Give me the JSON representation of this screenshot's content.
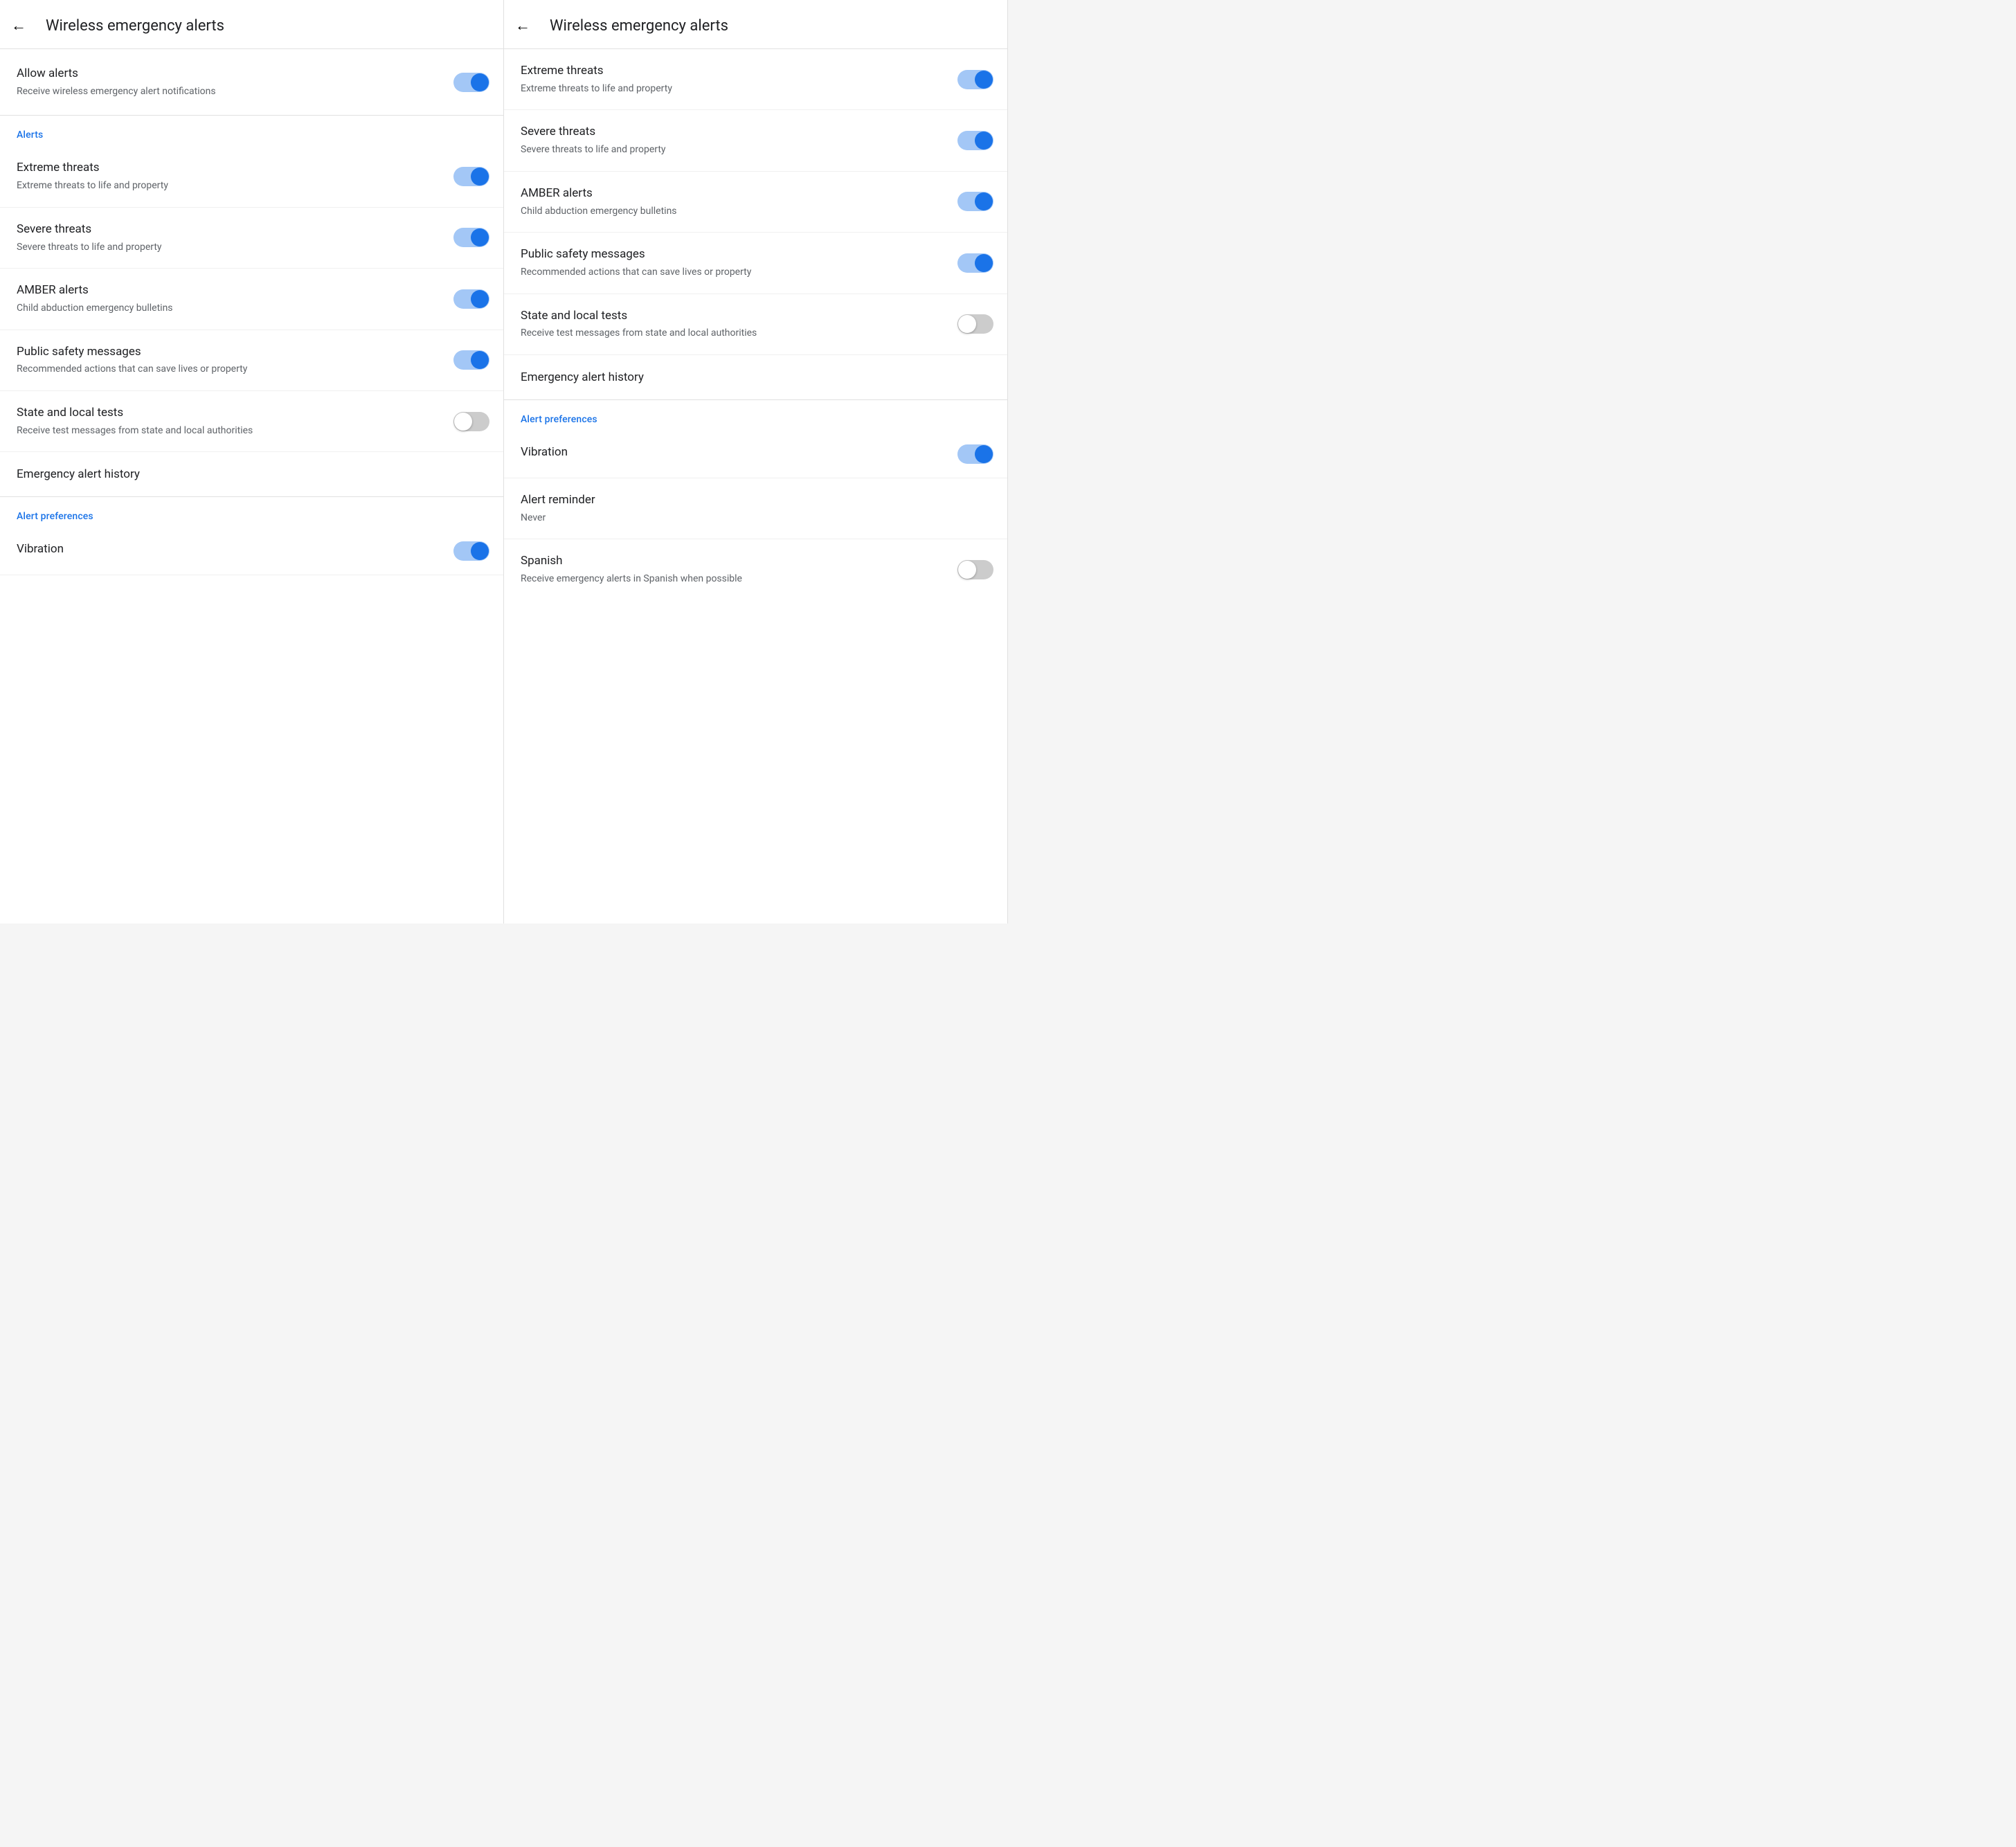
{
  "panels": [
    {
      "id": "panel-left",
      "header": {
        "back_label": "←",
        "title": "Wireless emergency alerts"
      },
      "sections": [
        {
          "id": "allow-section",
          "items": [
            {
              "id": "allow-alerts",
              "title": "Allow alerts",
              "subtitle": "Receive wireless emergency alert notifications",
              "has_toggle": true,
              "toggle_on": true
            }
          ]
        },
        {
          "id": "alerts-section",
          "section_label": "Alerts",
          "items": [
            {
              "id": "extreme-threats-left",
              "title": "Extreme threats",
              "subtitle": "Extreme threats to life and property",
              "has_toggle": true,
              "toggle_on": true
            },
            {
              "id": "severe-threats-left",
              "title": "Severe threats",
              "subtitle": "Severe threats to life and property",
              "has_toggle": true,
              "toggle_on": true
            },
            {
              "id": "amber-alerts-left",
              "title": "AMBER alerts",
              "subtitle": "Child abduction emergency bulletins",
              "has_toggle": true,
              "toggle_on": true
            },
            {
              "id": "public-safety-left",
              "title": "Public safety messages",
              "subtitle": "Recommended actions that can save lives or property",
              "has_toggle": true,
              "toggle_on": true
            },
            {
              "id": "state-local-left",
              "title": "State and local tests",
              "subtitle": "Receive test messages from state and local authorities",
              "has_toggle": true,
              "toggle_on": false
            },
            {
              "id": "emergency-history-left",
              "title": "Emergency alert history",
              "subtitle": null,
              "has_toggle": false
            }
          ]
        },
        {
          "id": "prefs-section-left",
          "section_label": "Alert preferences",
          "items": [
            {
              "id": "vibration-left",
              "title": "Vibration",
              "subtitle": null,
              "has_toggle": true,
              "toggle_on": true
            }
          ]
        }
      ]
    },
    {
      "id": "panel-right",
      "header": {
        "back_label": "←",
        "title": "Wireless emergency alerts"
      },
      "sections": [
        {
          "id": "alerts-section-right",
          "items": [
            {
              "id": "extreme-threats-right",
              "title": "Extreme threats",
              "subtitle": "Extreme threats to life and property",
              "has_toggle": true,
              "toggle_on": true
            },
            {
              "id": "severe-threats-right",
              "title": "Severe threats",
              "subtitle": "Severe threats to life and property",
              "has_toggle": true,
              "toggle_on": true
            },
            {
              "id": "amber-alerts-right",
              "title": "AMBER alerts",
              "subtitle": "Child abduction emergency bulletins",
              "has_toggle": true,
              "toggle_on": true
            },
            {
              "id": "public-safety-right",
              "title": "Public safety messages",
              "subtitle": "Recommended actions that can save lives or property",
              "has_toggle": true,
              "toggle_on": true
            },
            {
              "id": "state-local-right",
              "title": "State and local tests",
              "subtitle": "Receive test messages from state and local authorities",
              "has_toggle": true,
              "toggle_on": false
            },
            {
              "id": "emergency-history-right",
              "title": "Emergency alert history",
              "subtitle": null,
              "has_toggle": false
            }
          ]
        },
        {
          "id": "prefs-section-right",
          "section_label": "Alert preferences",
          "items": [
            {
              "id": "vibration-right",
              "title": "Vibration",
              "subtitle": null,
              "has_toggle": true,
              "toggle_on": true
            },
            {
              "id": "alert-reminder-right",
              "title": "Alert reminder",
              "subtitle": "Never",
              "has_toggle": false
            },
            {
              "id": "spanish-right",
              "title": "Spanish",
              "subtitle": "Receive emergency alerts in Spanish when possible",
              "has_toggle": true,
              "toggle_on": false
            }
          ]
        }
      ]
    }
  ]
}
